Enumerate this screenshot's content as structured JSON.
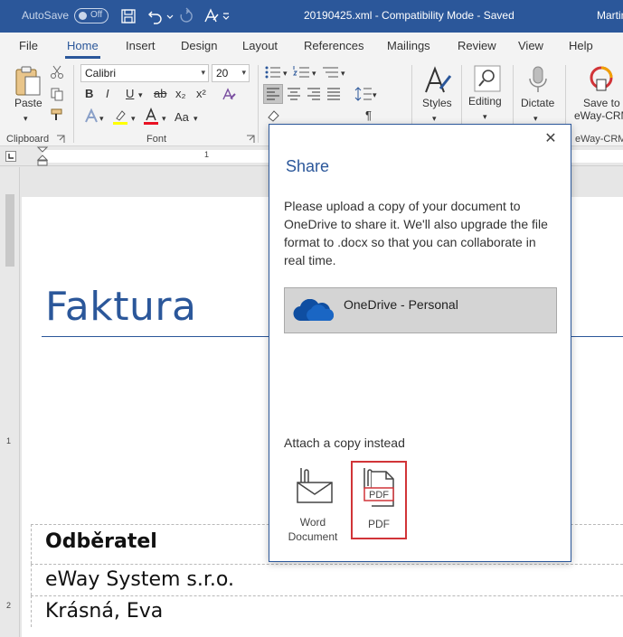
{
  "titlebar": {
    "autosave_label": "AutoSave",
    "autosave_state": "Off",
    "document_title": "20190425.xml - Compatibility Mode - Saved",
    "user": "Martin"
  },
  "tabs": [
    "File",
    "Home",
    "Insert",
    "Design",
    "Layout",
    "References",
    "Mailings",
    "Review",
    "View",
    "Help"
  ],
  "active_tab": "Home",
  "ribbon": {
    "paste_label": "Paste",
    "clipboard_label": "Clipboard",
    "font_name": "Calibri",
    "font_size": "20",
    "font_label": "Font",
    "styles_label": "Styles",
    "editing_label": "Editing",
    "dictate_label": "Dictate",
    "save_to_label_1": "Save to",
    "save_to_label_2": "eWay-CRM",
    "eway_group_label": "eWay-CRM",
    "bold": "B",
    "italic": "I",
    "underline": "U",
    "strike": "ab",
    "subscript": "x₂",
    "superscript": "x²",
    "font_case": "Aa",
    "pilcrow": "¶"
  },
  "ruler": {
    "mark": "1"
  },
  "vruler": {
    "mark1": "1",
    "mark2": "2"
  },
  "document": {
    "title": "Faktura",
    "rows": [
      "Odběratel",
      "eWay System s.r.o.",
      "Krásná, Eva"
    ]
  },
  "share_dialog": {
    "heading": "Share",
    "description": "Please upload a copy of your document to OneDrive to share it. We'll also upgrade the file format to .docx so that you can collaborate in real time.",
    "onedrive_label": "OneDrive - Personal",
    "attach_label": "Attach a copy instead",
    "word_option_line1": "Word",
    "word_option_line2": "Document",
    "pdf_option": "PDF",
    "pdf_icon_text": "PDF",
    "close_symbol": "✕"
  },
  "colors": {
    "word_blue": "#2b579a",
    "onedrive_blue": "#0f4ea1",
    "pdf_highlight": "#d13438"
  }
}
